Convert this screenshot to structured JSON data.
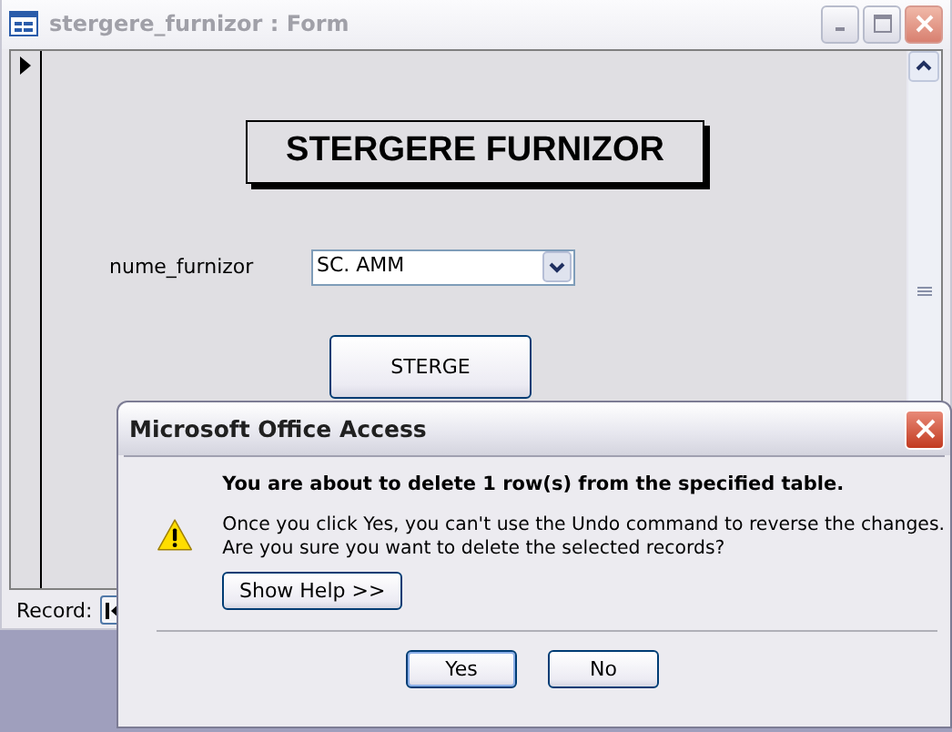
{
  "form_window": {
    "title": "stergere_furnizor : Form",
    "active": false
  },
  "form": {
    "heading": "STERGERE FURNIZOR",
    "field_label": "nume_furnizor",
    "field_value": "SC. AMM",
    "button": "STERGE",
    "record_label": "Record:"
  },
  "dialog": {
    "title": "Microsoft Office Access",
    "message": "You are about to delete 1 row(s) from the specified table.",
    "details": [
      "Once you click Yes, you can't use the Undo command to reverse the changes.",
      "Are you sure you want to delete the selected records?"
    ],
    "help_button": "Show Help >>",
    "buttons": [
      {
        "label": "Yes",
        "selected": true
      },
      {
        "label": "No",
        "selected": false
      }
    ]
  }
}
